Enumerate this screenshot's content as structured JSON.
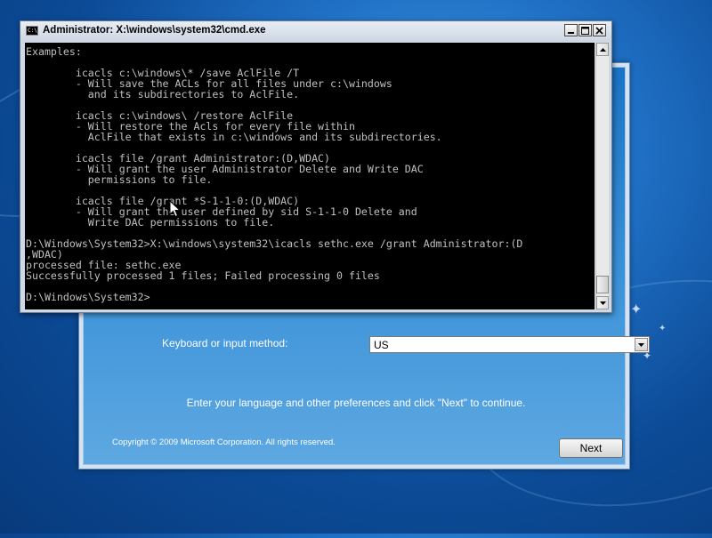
{
  "colors": {
    "desktop": "#1f6fc4",
    "console_bg": "#000000",
    "console_text": "#c0c0c0",
    "setup_panel": "#3d93d9"
  },
  "setup": {
    "keyboard_label": "Keyboard or input method:",
    "keyboard_value": "US",
    "hint": "Enter your language and other preferences and click \"Next\" to continue.",
    "copyright": "Copyright © 2009 Microsoft Corporation. All rights reserved.",
    "next_label": "Next"
  },
  "cmd": {
    "title": "Administrator: X:\\windows\\system32\\cmd.exe",
    "icon": "cmd-window-icon",
    "output": "Examples:\n\n        icacls c:\\windows\\* /save AclFile /T\n        - Will save the ACLs for all files under c:\\windows\n          and its subdirectories to AclFile.\n\n        icacls c:\\windows\\ /restore AclFile\n        - Will restore the Acls for every file within\n          AclFile that exists in c:\\windows and its subdirectories.\n\n        icacls file /grant Administrator:(D,WDAC)\n        - Will grant the user Administrator Delete and Write DAC\n          permissions to file.\n\n        icacls file /grant *S-1-1-0:(D,WDAC)\n        - Will grant the user defined by sid S-1-1-0 Delete and\n          Write DAC permissions to file.\n\nD:\\Windows\\System32>X:\\windows\\system32\\icacls sethc.exe /grant Administrator:(D\n,WDAC)\nprocessed file: sethc.exe\nSuccessfully processed 1 files; Failed processing 0 files\n\nD:\\Windows\\System32>"
  }
}
